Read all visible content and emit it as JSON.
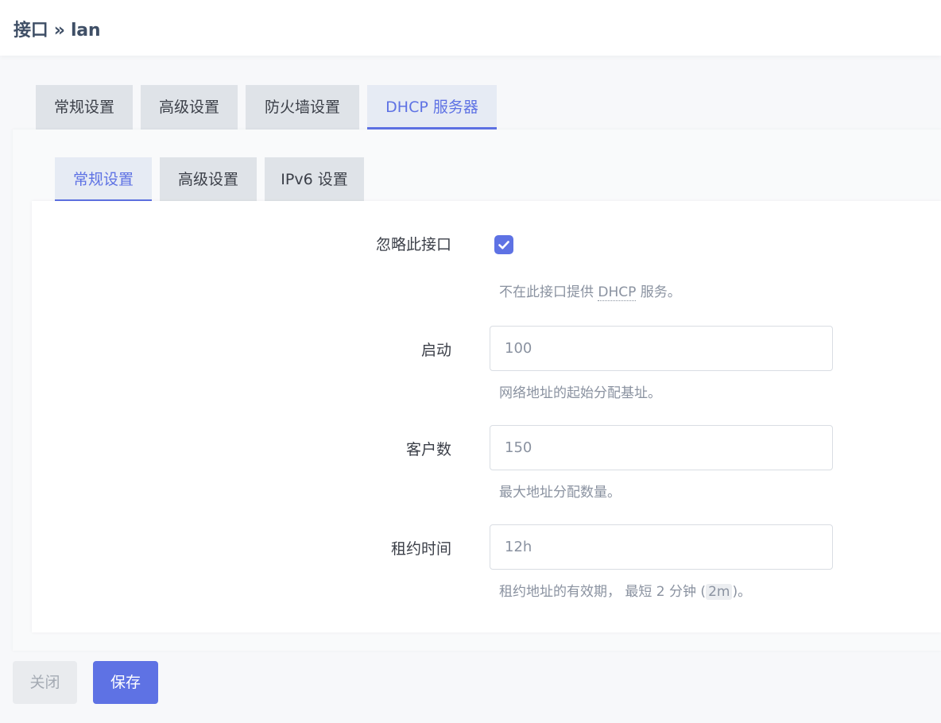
{
  "header": {
    "title": "接口 » lan"
  },
  "main_tabs": [
    {
      "label": "常规设置",
      "active": false
    },
    {
      "label": "高级设置",
      "active": false
    },
    {
      "label": "防火墙设置",
      "active": false
    },
    {
      "label": "DHCP 服务器",
      "active": true
    }
  ],
  "sub_tabs": [
    {
      "label": "常规设置",
      "active": true
    },
    {
      "label": "高级设置",
      "active": false
    },
    {
      "label": "IPv6 设置",
      "active": false
    }
  ],
  "form": {
    "ignore": {
      "label": "忽略此接口",
      "checked": true,
      "help_prefix": "不在此接口提供 ",
      "help_abbr": "DHCP",
      "help_suffix": " 服务。"
    },
    "start": {
      "label": "启动",
      "value": "100",
      "help": "网络地址的起始分配基址。"
    },
    "limit": {
      "label": "客户数",
      "value": "150",
      "help": "最大地址分配数量。"
    },
    "leasetime": {
      "label": "租约时间",
      "value": "12h",
      "help_prefix": "租约地址的有效期， 最短 2 分钟 (",
      "help_code": "2m",
      "help_suffix": ")。"
    }
  },
  "buttons": {
    "close_label": "关闭",
    "save_label": "保存"
  },
  "icons": {
    "checkbox": "check-icon"
  },
  "colors": {
    "accent": "#5e72e4",
    "tab_bg": "#dfe3e8",
    "help_text": "#8a92a0"
  }
}
